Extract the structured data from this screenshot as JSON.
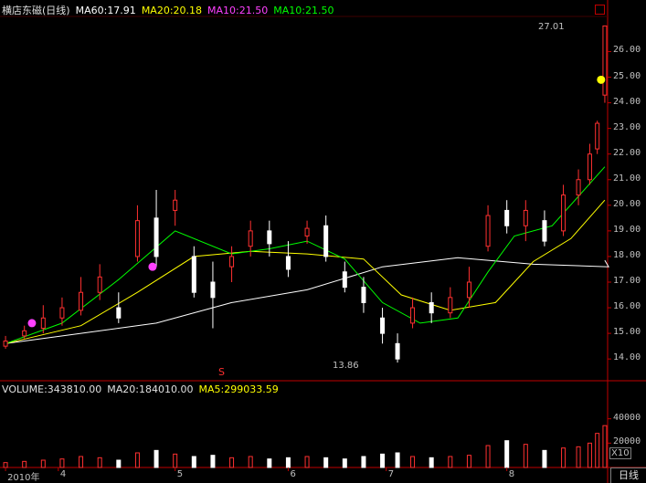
{
  "stock": {
    "name": "横店东磁(日线)",
    "ma60": "MA60:17.91",
    "ma20": "MA20:20.18",
    "ma10": "MA10:21.50",
    "ma10b": "MA10:21.50"
  },
  "volume": {
    "label": "VOLUME:343810.00",
    "ma20": "MA20:184010.00",
    "ma5": "MA5:299033.59",
    "unit": "X10"
  },
  "annotations": {
    "high": "27.01",
    "low": "13.86",
    "marker": "S"
  },
  "period_tab": "日线",
  "colors": {
    "up": "#ff3030",
    "down": "#ffffff",
    "ma60": "#ffffff",
    "ma20": "#ffff00",
    "ma10": "#00ff00",
    "magenta": "#ff40ff",
    "axis": "#c00000"
  },
  "chart_data": {
    "type": "candlestick",
    "y_ticks": [
      "26.00",
      "25.00",
      "24.00",
      "23.00",
      "22.00",
      "21.00",
      "20.00",
      "19.00",
      "18.00",
      "17.00",
      "16.00",
      "15.00",
      "14.00"
    ],
    "ylim": [
      13.4,
      27.3
    ],
    "volume_ticks": [
      "40000",
      "20000"
    ],
    "volume_ylim": [
      0,
      60000
    ],
    "x_ticks": [
      "2010年",
      "4",
      "5",
      "6",
      "7",
      "8"
    ],
    "x_tick_index": [
      0,
      14,
      45,
      75,
      101,
      133
    ],
    "ma60_points": [
      [
        0,
        14.6
      ],
      [
        20,
        15.0
      ],
      [
        40,
        15.4
      ],
      [
        60,
        16.2
      ],
      [
        80,
        16.7
      ],
      [
        100,
        17.6
      ],
      [
        120,
        17.95
      ],
      [
        140,
        17.7
      ],
      [
        160,
        17.6
      ],
      [
        159,
        17.85
      ]
    ],
    "ma20_points": [
      [
        0,
        14.6
      ],
      [
        20,
        15.3
      ],
      [
        35,
        16.6
      ],
      [
        50,
        18.0
      ],
      [
        65,
        18.2
      ],
      [
        80,
        18.1
      ],
      [
        95,
        17.9
      ],
      [
        105,
        16.5
      ],
      [
        118,
        15.9
      ],
      [
        130,
        16.2
      ],
      [
        140,
        17.8
      ],
      [
        150,
        18.7
      ],
      [
        159,
        20.2
      ]
    ],
    "ma10_points": [
      [
        0,
        14.6
      ],
      [
        15,
        15.4
      ],
      [
        30,
        17.1
      ],
      [
        45,
        19.0
      ],
      [
        60,
        18.1
      ],
      [
        70,
        18.3
      ],
      [
        80,
        18.6
      ],
      [
        90,
        17.9
      ],
      [
        100,
        16.2
      ],
      [
        110,
        15.4
      ],
      [
        120,
        15.6
      ],
      [
        128,
        17.4
      ],
      [
        135,
        18.8
      ],
      [
        145,
        19.2
      ],
      [
        159,
        21.5
      ]
    ],
    "candles": [
      {
        "i": 0,
        "o": 14.5,
        "c": 14.7,
        "h": 14.9,
        "l": 14.4
      },
      {
        "i": 5,
        "o": 14.9,
        "c": 15.1,
        "h": 15.3,
        "l": 14.8
      },
      {
        "i": 10,
        "o": 15.2,
        "c": 15.6,
        "h": 16.1,
        "l": 15.0
      },
      {
        "i": 15,
        "o": 15.6,
        "c": 16.0,
        "h": 16.4,
        "l": 15.3
      },
      {
        "i": 20,
        "o": 15.9,
        "c": 16.6,
        "h": 17.2,
        "l": 15.7
      },
      {
        "i": 25,
        "o": 16.6,
        "c": 17.2,
        "h": 17.7,
        "l": 16.3
      },
      {
        "i": 30,
        "o": 16.0,
        "c": 15.6,
        "h": 16.6,
        "l": 15.4
      },
      {
        "i": 35,
        "o": 18.0,
        "c": 19.4,
        "h": 20.0,
        "l": 17.8
      },
      {
        "i": 40,
        "o": 19.5,
        "c": 18.0,
        "h": 20.6,
        "l": 17.6
      },
      {
        "i": 45,
        "o": 19.8,
        "c": 20.2,
        "h": 20.6,
        "l": 19.2
      },
      {
        "i": 50,
        "o": 18.0,
        "c": 16.6,
        "h": 18.4,
        "l": 16.4
      },
      {
        "i": 55,
        "o": 17.0,
        "c": 16.4,
        "h": 17.8,
        "l": 15.2
      },
      {
        "i": 60,
        "o": 17.6,
        "c": 18.0,
        "h": 18.4,
        "l": 17.0
      },
      {
        "i": 65,
        "o": 18.4,
        "c": 19.0,
        "h": 19.4,
        "l": 18.0
      },
      {
        "i": 70,
        "o": 19.0,
        "c": 18.5,
        "h": 19.4,
        "l": 18.0
      },
      {
        "i": 75,
        "o": 18.0,
        "c": 17.5,
        "h": 18.6,
        "l": 17.2
      },
      {
        "i": 80,
        "o": 18.8,
        "c": 19.1,
        "h": 19.4,
        "l": 18.5
      },
      {
        "i": 85,
        "o": 19.2,
        "c": 18.0,
        "h": 19.6,
        "l": 17.8
      },
      {
        "i": 90,
        "o": 17.4,
        "c": 16.8,
        "h": 17.8,
        "l": 16.6
      },
      {
        "i": 95,
        "o": 16.8,
        "c": 16.2,
        "h": 17.2,
        "l": 15.8
      },
      {
        "i": 100,
        "o": 15.6,
        "c": 15.0,
        "h": 16.0,
        "l": 14.6
      },
      {
        "i": 104,
        "o": 14.6,
        "c": 14.0,
        "h": 15.0,
        "l": 13.86
      },
      {
        "i": 108,
        "o": 15.4,
        "c": 16.0,
        "h": 16.4,
        "l": 15.2
      },
      {
        "i": 113,
        "o": 16.2,
        "c": 15.8,
        "h": 16.6,
        "l": 15.4
      },
      {
        "i": 118,
        "o": 15.8,
        "c": 16.4,
        "h": 16.8,
        "l": 15.6
      },
      {
        "i": 123,
        "o": 16.4,
        "c": 17.0,
        "h": 17.6,
        "l": 16.0
      },
      {
        "i": 128,
        "o": 18.4,
        "c": 19.6,
        "h": 20.0,
        "l": 18.2
      },
      {
        "i": 133,
        "o": 19.8,
        "c": 19.2,
        "h": 20.2,
        "l": 18.9
      },
      {
        "i": 138,
        "o": 19.2,
        "c": 19.8,
        "h": 20.2,
        "l": 18.6
      },
      {
        "i": 143,
        "o": 19.4,
        "c": 18.6,
        "h": 19.8,
        "l": 18.4
      },
      {
        "i": 148,
        "o": 19.0,
        "c": 20.4,
        "h": 20.8,
        "l": 18.8
      },
      {
        "i": 152,
        "o": 20.4,
        "c": 21.0,
        "h": 21.4,
        "l": 20.0
      },
      {
        "i": 155,
        "o": 21.0,
        "c": 22.0,
        "h": 22.4,
        "l": 20.8
      },
      {
        "i": 157,
        "o": 22.2,
        "c": 23.2,
        "h": 23.3,
        "l": 22.0
      },
      {
        "i": 159,
        "o": 24.3,
        "c": 27.0,
        "h": 27.01,
        "l": 24.0
      }
    ],
    "volumes": [
      4000,
      5000,
      6000,
      7000,
      9000,
      8000,
      6000,
      12000,
      14000,
      11000,
      9000,
      10000,
      8000,
      9000,
      7000,
      8000,
      9000,
      8000,
      7000,
      9000,
      11000,
      12000,
      9000,
      8000,
      9000,
      10000,
      18000,
      22000,
      19000,
      14000,
      16000,
      17000,
      20000,
      28000,
      34381
    ],
    "magenta_dots": [
      [
        7,
        15.4
      ],
      [
        39,
        17.6
      ]
    ],
    "yellow_dot": [
      158,
      24.9
    ]
  }
}
